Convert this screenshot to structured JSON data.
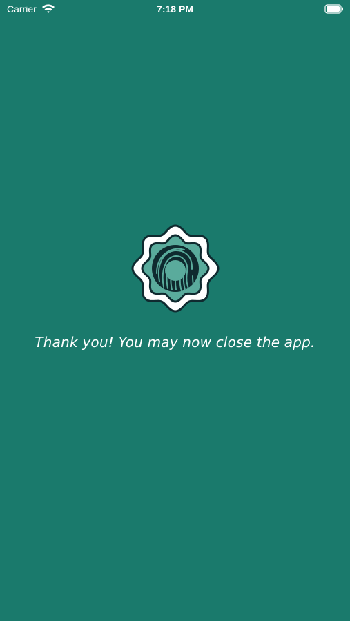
{
  "status_bar": {
    "carrier": "Carrier",
    "time": "7:18 PM",
    "wifi_icon": "wifi-icon",
    "battery_icon": "battery-icon"
  },
  "main": {
    "logo_icon": "fingerprint-badge-icon",
    "message": "Thank you! You may now close the app."
  },
  "colors": {
    "background": "#1a7a6c",
    "badge_inner": "#5aab9c",
    "badge_outline": "#0f2a2f",
    "text": "#ffffff"
  }
}
